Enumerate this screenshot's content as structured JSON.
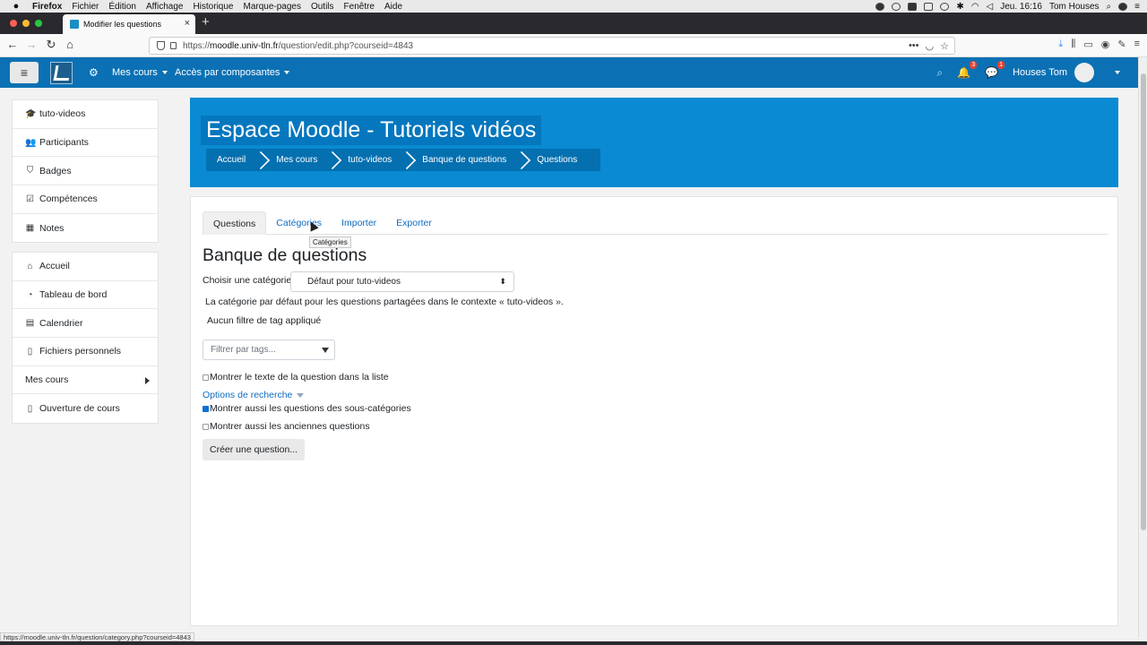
{
  "os_menu": {
    "app": "Firefox",
    "items": [
      "Fichier",
      "Édition",
      "Affichage",
      "Historique",
      "Marque-pages",
      "Outils",
      "Fenêtre",
      "Aide"
    ],
    "clock": "Jeu. 16:16",
    "user": "Tom Houses"
  },
  "browser": {
    "tab_title": "Modifier les questions",
    "url_host": "moodle.univ-tln.fr",
    "url_prefix": "https://",
    "url_path": "/question/edit.php?courseid=4843",
    "status_url": "https://moodle.univ-tln.fr/question/category.php?courseid=4843"
  },
  "header": {
    "nav": [
      "Mes cours",
      "Accès par composantes"
    ],
    "notifications_count": "3",
    "messages_count": "1",
    "user_name": "Houses Tom"
  },
  "sidebar": {
    "course_items": [
      {
        "label": "tuto-videos",
        "icon": "graduation-cap-icon",
        "glyph": "🎓"
      },
      {
        "label": "Participants",
        "icon": "users-icon",
        "glyph": "👥"
      },
      {
        "label": "Badges",
        "icon": "shield-icon",
        "glyph": "⛉"
      },
      {
        "label": "Compétences",
        "icon": "checklist-icon",
        "glyph": "☑"
      },
      {
        "label": "Notes",
        "icon": "table-icon",
        "glyph": "▦"
      }
    ],
    "site_items": [
      {
        "label": "Accueil",
        "icon": "home-icon",
        "glyph": "⌂"
      },
      {
        "label": "Tableau de bord",
        "icon": "dashboard-icon",
        "glyph": "◔"
      },
      {
        "label": "Calendrier",
        "icon": "calendar-icon",
        "glyph": "▤"
      },
      {
        "label": "Fichiers personnels",
        "icon": "file-icon",
        "glyph": "▯"
      },
      {
        "label": "Mes cours",
        "icon": "",
        "glyph": ""
      },
      {
        "label": "Ouverture de cours",
        "icon": "file-icon",
        "glyph": "▯"
      }
    ]
  },
  "banner": {
    "title": "Espace Moodle - Tutoriels vidéos",
    "breadcrumb": [
      "Accueil",
      "Mes cours",
      "tuto-videos",
      "Banque de questions",
      "Questions"
    ]
  },
  "main": {
    "tabs": [
      "Questions",
      "Catégories",
      "Importer",
      "Exporter"
    ],
    "active_tab": "Questions",
    "tooltip": "Catégories",
    "page_title": "Banque de questions",
    "category_label": "Choisir une catégorie",
    "category_value": "Défaut pour tuto-videos",
    "category_description": "La catégorie par défaut pour les questions partagées dans le contexte « tuto-videos ».",
    "tag_filter_info": "Aucun filtre de tag appliqué",
    "tag_filter_placeholder": "Filtrer par tags...",
    "show_question_text": "Montrer le texte de la question dans la liste",
    "search_options": "Options de recherche",
    "show_subcategories": "Montrer aussi les questions des sous-catégories",
    "show_old_questions": "Montrer aussi les anciennes questions",
    "create_button": "Créer une question..."
  }
}
